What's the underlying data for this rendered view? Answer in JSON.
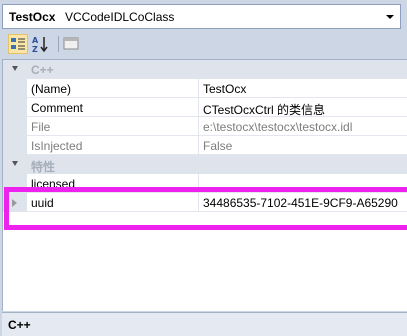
{
  "selector": {
    "object_name": "TestOcx",
    "object_type": "VCCodeIDLCoClass"
  },
  "toolbar": {
    "buttons": [
      {
        "icon": "categorized-icon",
        "active": true
      },
      {
        "icon": "alphabetical-sort-icon",
        "active": false
      },
      {
        "icon": "property-pages-icon",
        "active": false
      }
    ]
  },
  "grid": {
    "category_cpp": "C++",
    "category_features": "特性",
    "rows": {
      "name": {
        "label": "(Name)",
        "value": "TestOcx"
      },
      "comment": {
        "label": "Comment",
        "value": "CTestOcxCtrl 的类信息"
      },
      "file": {
        "label": "File",
        "value": "e:\\testocx\\testocx\\testocx.idl"
      },
      "isinjected": {
        "label": "IsInjected",
        "value": "False"
      },
      "licensed": {
        "label": "licensed",
        "value": ""
      },
      "uuid": {
        "label": "uuid",
        "value": "34486535-7102-451E-9CF9-A65290"
      }
    }
  },
  "description": {
    "title": "C++"
  },
  "colors": {
    "highlight": "#ee22ee",
    "gutter": "#dfe4ec",
    "background": "#cdd6e4"
  }
}
